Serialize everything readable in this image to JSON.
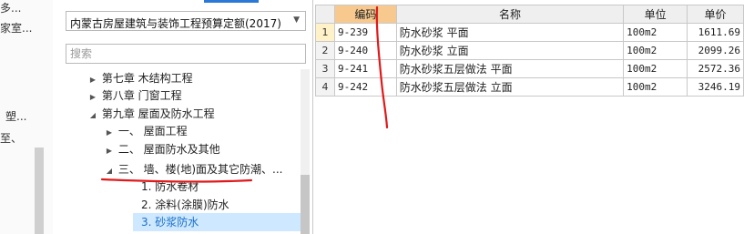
{
  "left_strip": {
    "fragments": [
      "多...",
      "家室...",
      "塑...",
      "至、"
    ]
  },
  "tree_panel": {
    "quota_select": {
      "value": "内蒙古房屋建筑与装饰工程预算定额(2017)"
    },
    "search": {
      "placeholder": "搜索"
    },
    "nodes": [
      {
        "toggle": "▶",
        "label": "第七章 木结构工程"
      },
      {
        "toggle": "▶",
        "label": "第八章 门窗工程"
      },
      {
        "toggle": "◢",
        "label": "第九章 屋面及防水工程"
      },
      {
        "toggle": "▶",
        "label": "一、 屋面工程"
      },
      {
        "toggle": "▶",
        "label": "二、 屋面防水及其他"
      },
      {
        "toggle": "◢",
        "label": "三、 墙、楼(地)面及其它防潮、..."
      },
      {
        "label": "1. 防水卷材"
      },
      {
        "label": "2. 涂料(涂膜)防水"
      },
      {
        "label": "3. 砂浆防水"
      }
    ]
  },
  "grid": {
    "columns": [
      "编码",
      "名称",
      "单位",
      "单价"
    ],
    "rows": [
      {
        "no": "1",
        "code": "9-239",
        "name": "防水砂浆 平面",
        "unit": "100m2",
        "price": "1611.69"
      },
      {
        "no": "2",
        "code": "9-240",
        "name": "防水砂浆 立面",
        "unit": "100m2",
        "price": "2099.26"
      },
      {
        "no": "3",
        "code": "9-241",
        "name": "防水砂浆五层做法 平面",
        "unit": "100m2",
        "price": "2572.36"
      },
      {
        "no": "4",
        "code": "9-242",
        "name": "防水砂浆五层做法 立面",
        "unit": "100m2",
        "price": "3246.19"
      }
    ]
  },
  "colors": {
    "accent": "#2b78d6",
    "selected_bg": "#cde8ff",
    "header_highlight": "#f7c98f",
    "annotation_ink": "#e0191b"
  }
}
